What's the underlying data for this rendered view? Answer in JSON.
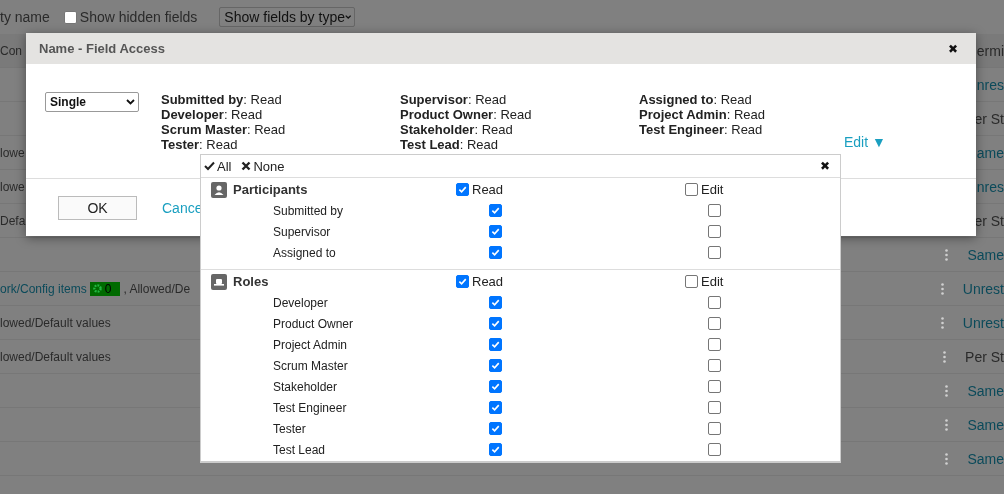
{
  "toolbar": {
    "name_fragment": "ty name",
    "show_hidden": {
      "label": "Show hidden fields",
      "checked": false
    },
    "view_select": "Show fields by type"
  },
  "table": {
    "header": {
      "left": "Con",
      "right": "ermi"
    },
    "rows": [
      {
        "left": "",
        "right": "nres",
        "link": true,
        "menu": false
      },
      {
        "left": "",
        "right": "er St",
        "link": false,
        "menu": false
      },
      {
        "left": "lowe",
        "right": "ame",
        "link": true,
        "menu": false
      },
      {
        "left": "lowe",
        "right": "nres",
        "link": true,
        "menu": false
      },
      {
        "left": "Defa",
        "right": "er St",
        "link": false,
        "menu": false
      },
      {
        "left": "",
        "right": "Same",
        "link": true,
        "menu": true
      },
      {
        "left": "ork/Config items",
        "badge": "0",
        "left_tail": ", Allowed/De",
        "right": "Unrest",
        "link": true,
        "menu": true
      },
      {
        "left": "lowed/Default values",
        "right": "Unrest",
        "link": true,
        "menu": true
      },
      {
        "left": "lowed/Default values",
        "right": "Per St",
        "link": false,
        "menu": true
      },
      {
        "left": "",
        "right": "Same",
        "link": true,
        "menu": true
      },
      {
        "left": "",
        "right": "Same",
        "link": true,
        "menu": true
      },
      {
        "left": "",
        "right": "Same",
        "link": true,
        "menu": true
      }
    ]
  },
  "dialog": {
    "title": "Name - Field Access",
    "close": "✖",
    "mode": "Single",
    "summary": [
      [
        "**Submitted by**: Read",
        "**Developer**: Read",
        "**Scrum Master**: Read",
        "**Tester**: Read"
      ],
      [
        "**Supervisor**: Read",
        "**Product Owner**: Read",
        "**Stakeholder**: Read",
        "**Test Lead**: Read"
      ],
      [
        "**Assigned to**: Read",
        "**Project Admin**: Read",
        "**Test Engineer**: Read"
      ]
    ],
    "edit_link": "Edit ▼",
    "ok": "OK",
    "cancel": "Cance"
  },
  "popup": {
    "all": "All",
    "none": "None",
    "close": "✖",
    "groups": [
      {
        "kind": "person",
        "name": "Participants",
        "read": {
          "label": "Read",
          "checked": true
        },
        "edit": {
          "label": "Edit",
          "checked": false
        },
        "items": [
          {
            "name": "Submitted by",
            "read": true,
            "edit": false
          },
          {
            "name": "Supervisor",
            "read": true,
            "edit": false
          },
          {
            "name": "Assigned to",
            "read": true,
            "edit": false
          }
        ]
      },
      {
        "kind": "role",
        "name": "Roles",
        "read": {
          "label": "Read",
          "checked": true
        },
        "edit": {
          "label": "Edit",
          "checked": false
        },
        "items": [
          {
            "name": "Developer",
            "read": true,
            "edit": false
          },
          {
            "name": "Product Owner",
            "read": true,
            "edit": false
          },
          {
            "name": "Project Admin",
            "read": true,
            "edit": false
          },
          {
            "name": "Scrum Master",
            "read": true,
            "edit": false
          },
          {
            "name": "Stakeholder",
            "read": true,
            "edit": false
          },
          {
            "name": "Test Engineer",
            "read": true,
            "edit": false
          },
          {
            "name": "Tester",
            "read": true,
            "edit": false
          },
          {
            "name": "Test Lead",
            "read": true,
            "edit": false
          }
        ]
      }
    ]
  }
}
